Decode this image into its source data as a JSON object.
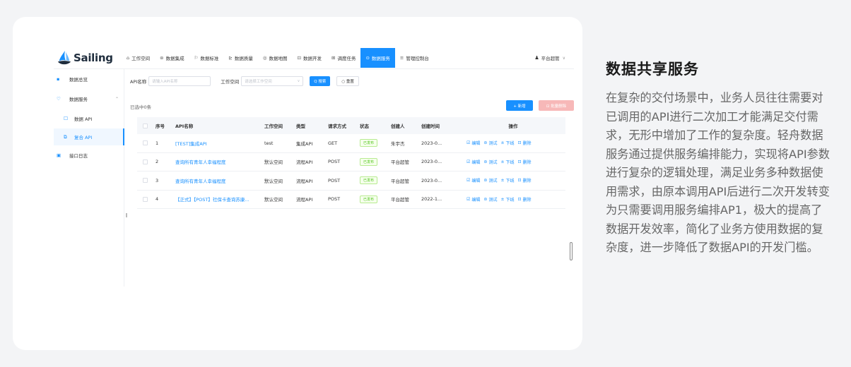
{
  "app": {
    "logo_text": "Sailing",
    "nav": [
      {
        "icon": "⌂",
        "label": "工作空间"
      },
      {
        "icon": "⊜",
        "label": "数据集成"
      },
      {
        "icon": "⚐",
        "label": "数据标准"
      },
      {
        "icon": "⊵",
        "label": "数据质量"
      },
      {
        "icon": "◎",
        "label": "数据地图"
      },
      {
        "icon": "⊡",
        "label": "数据开发"
      },
      {
        "icon": "⊞",
        "label": "调度任务"
      },
      {
        "icon": "⊙",
        "label": "数据服务"
      },
      {
        "icon": "≡",
        "label": "管理控制台"
      }
    ],
    "user": {
      "name": "平台超管",
      "chevron": "∨"
    },
    "sidebar": [
      {
        "icon": "▪",
        "label": "数据总览"
      },
      {
        "icon": "♡",
        "label": "数据服务",
        "expand": "⌃"
      },
      {
        "icon": "☐",
        "label": "数据 API"
      },
      {
        "icon": "⧉",
        "label": "复合 API"
      },
      {
        "icon": "▣",
        "label": "接口日志"
      }
    ],
    "filter": {
      "api_name_label": "API名称",
      "api_name_placeholder": "请输入API名称",
      "workspace_label": "工作空间",
      "workspace_placeholder": "请选择工作空间",
      "search_label": "Q 搜索",
      "reset_label": "○ 重置"
    },
    "selected_text": "已选中0条",
    "add_label": "+ 新增",
    "batch_delete_label": "⊡ 批量删除",
    "columns": [
      "序号",
      "API名称",
      "工作空间",
      "类型",
      "请求方式",
      "状态",
      "创建人",
      "创建时间",
      "操作"
    ],
    "ops": [
      {
        "icon": "☑",
        "label": "编辑"
      },
      {
        "icon": "⊜",
        "label": "测试"
      },
      {
        "icon": "±",
        "label": "下线"
      },
      {
        "icon": "⊡",
        "label": "删除"
      }
    ],
    "rows": [
      {
        "idx": "1",
        "name": "[TEST]集成API",
        "ws": "test",
        "type": "集成API",
        "method": "GET",
        "status": "已发布",
        "creator": "朱宇杰",
        "time": "2023-0..."
      },
      {
        "idx": "2",
        "name": "查询所有青年人幸福程度",
        "ws": "默认空间",
        "type": "流程API",
        "method": "POST",
        "status": "已发布",
        "creator": "平台超管",
        "time": "2023-0..."
      },
      {
        "idx": "3",
        "name": "查询所有青年人幸福程度",
        "ws": "默认空间",
        "type": "流程API",
        "method": "POST",
        "status": "已发布",
        "creator": "平台超管",
        "time": "2023-0..."
      },
      {
        "idx": "4",
        "name": "【正式】【POST】社保卡查询苏康...",
        "ws": "默认空间",
        "type": "流程API",
        "method": "POST",
        "status": "已发布",
        "creator": "平台超管",
        "time": "2022-1..."
      }
    ]
  },
  "text": {
    "heading": "数据共享服务",
    "body": "在复杂的交付场景中，业务人员往往需要对已调用的API进行二次加工才能满足交付需求，无形中增加了工作的复杂度。轻舟数据服务通过提供服务编排能力，实现将API参数进行复杂的逻辑处理，满足业务多种数据使用需求，由原本调用API后进行二次开发转变为只需要调用服务编排AP1，极大的提高了数据开发效率，简化了业务方使用数据的复杂度，进一步降低了数据API的开发门槛。"
  },
  "colors": {
    "accent": "#1890ff",
    "success": "#52c41a",
    "danger_light": "#f7b8b8"
  }
}
